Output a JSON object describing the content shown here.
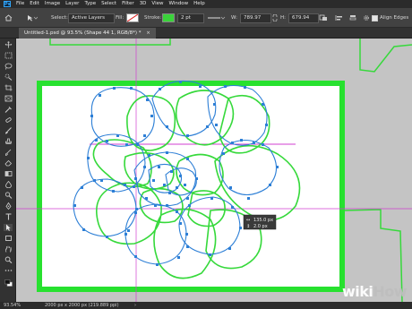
{
  "app": {
    "logo_text": "Ps"
  },
  "menu": {
    "items": [
      "File",
      "Edit",
      "Image",
      "Layer",
      "Type",
      "Select",
      "Filter",
      "3D",
      "View",
      "Window",
      "Help"
    ]
  },
  "options_bar": {
    "select_label": "Select:",
    "select_value": "Active Layers",
    "fill_label": "Fill:",
    "stroke_label": "Stroke:",
    "stroke_color": "#3ad33a",
    "stroke_width": "2 pt",
    "w_label": "W:",
    "w_value": "789.97",
    "h_label": "H:",
    "h_value": "679.94",
    "align_edges_label": "Align Edges"
  },
  "document_tab": {
    "title": "Untitled-1.psd @ 93.5% (Shape 44 1, RGB/8*) *"
  },
  "transform_hud": {
    "width": "135.0 px",
    "height": "2.0 px"
  },
  "status_bar": {
    "zoom": "93.54%",
    "doc_info": "2000 px x 2000 px (219.889 ppi)"
  },
  "watermark": {
    "wiki": "wiki",
    "how": "How"
  },
  "colors": {
    "path_blue": "#2d7fd6",
    "shape_green": "#36d93b",
    "guide_magenta": "#d03fd0",
    "canvas_bg": "#ffffff",
    "workspace": "#c4c4c4"
  },
  "tools": [
    "move-icon",
    "artboard-icon",
    "marquee-icon",
    "lasso-icon",
    "quick-select-icon",
    "crop-icon",
    "frame-icon",
    "eyedropper-icon",
    "spot-heal-icon",
    "brush-icon",
    "clone-stamp-icon",
    "history-brush-icon",
    "eraser-icon",
    "gradient-icon",
    "blur-icon",
    "dodge-icon",
    "pen-icon",
    "type-icon",
    "path-select-icon",
    "shape-icon",
    "hand-icon",
    "zoom-icon",
    "more-icon",
    "color-swatches-icon"
  ]
}
